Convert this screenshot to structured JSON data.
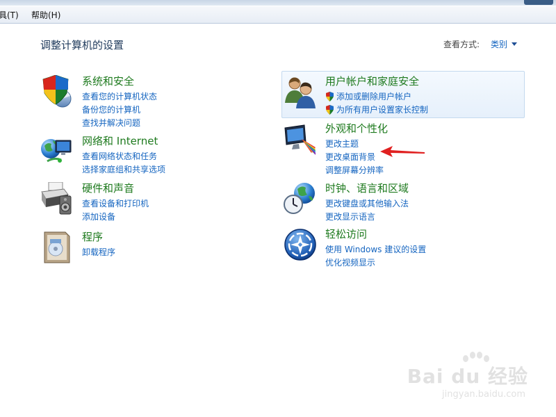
{
  "menubar": {
    "items": [
      {
        "label": "具(T)"
      },
      {
        "label": "帮助(H)"
      }
    ]
  },
  "page": {
    "title": "调整计算机的设置",
    "viewby_label": "查看方式:",
    "viewby_value": "类别"
  },
  "categories": [
    {
      "title": "系统和安全",
      "icon": "shield-icon",
      "links": [
        "查看您的计算机状态",
        "备份您的计算机",
        "查找并解决问题"
      ]
    },
    {
      "title": "网络和 Internet",
      "icon": "network-globe-icon",
      "links": [
        "查看网络状态和任务",
        "选择家庭组和共享选项"
      ]
    },
    {
      "title": "硬件和声音",
      "icon": "printer-speaker-icon",
      "links": [
        "查看设备和打印机",
        "添加设备"
      ]
    },
    {
      "title": "程序",
      "icon": "programs-box-icon",
      "links": [
        "卸载程序"
      ]
    },
    {
      "title": "用户帐户和家庭安全",
      "icon": "users-icon",
      "links": [
        "添加或删除用户帐户",
        "为所有用户设置家长控制"
      ]
    },
    {
      "title": "外观和个性化",
      "icon": "monitor-palette-icon",
      "links": [
        "更改主题",
        "更改桌面背景",
        "调整屏幕分辨率"
      ]
    },
    {
      "title": "时钟、语言和区域",
      "icon": "clock-globe-icon",
      "links": [
        "更改键盘或其他输入法",
        "更改显示语言"
      ]
    },
    {
      "title": "轻松访问",
      "icon": "ease-of-access-icon",
      "links": [
        "使用 Windows 建议的设置",
        "优化视频显示"
      ]
    }
  ],
  "watermark": {
    "main": "Bai du 经验",
    "sub": "jingyan.baidu.com"
  },
  "colors": {
    "category_title": "#1e7a1e",
    "link": "#1565c0",
    "page_title": "#1e395b",
    "annotation_arrow": "#e02020"
  }
}
